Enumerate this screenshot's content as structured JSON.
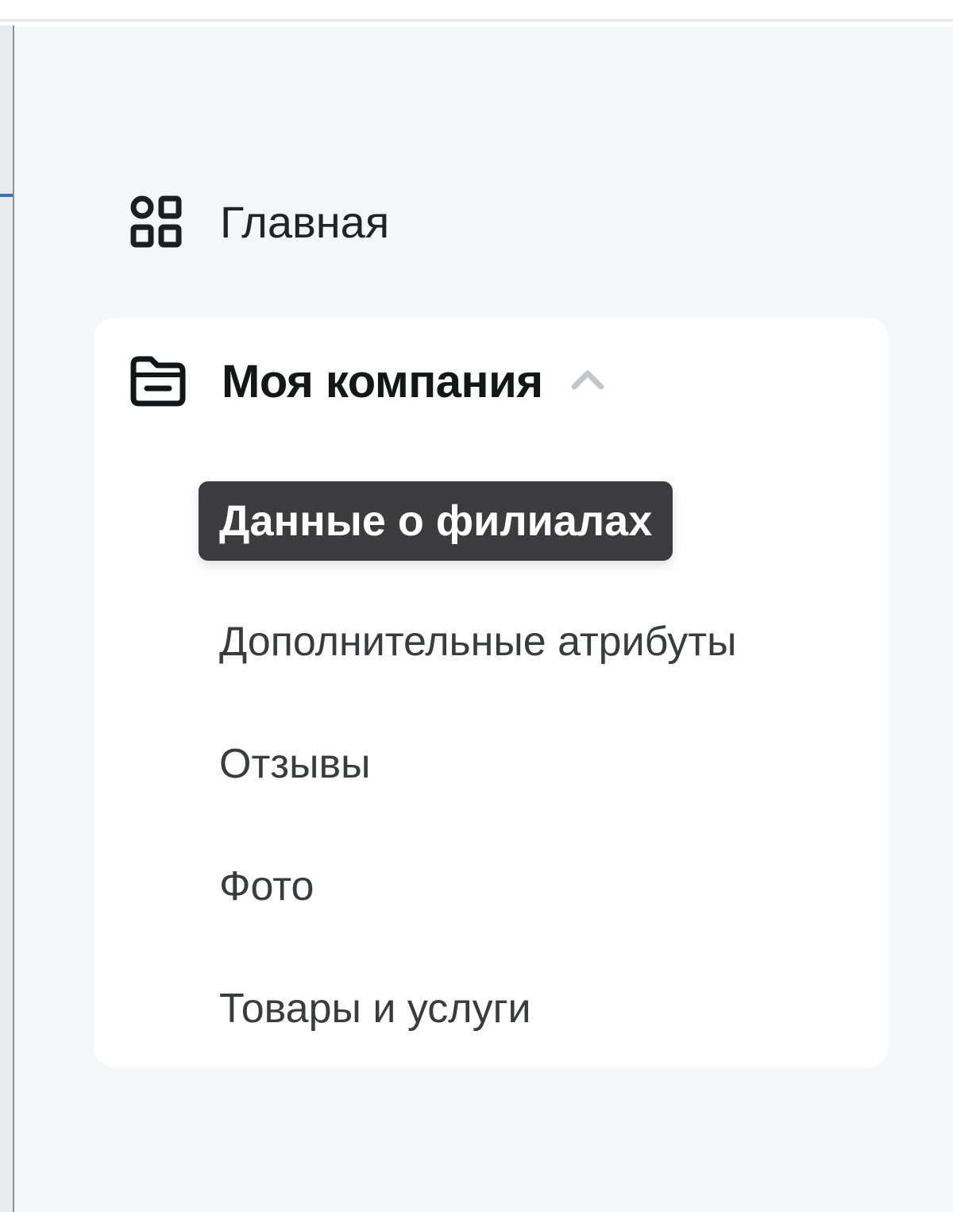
{
  "sidebar": {
    "home": {
      "label": "Главная",
      "icon": "dashboard-grid-icon"
    },
    "group": {
      "label": "Моя компания",
      "icon": "folder-icon",
      "expanded_icon": "chevron-up-icon",
      "items": [
        {
          "label": "Данные о филиалах",
          "active": true
        },
        {
          "label": "Дополнительные атрибуты",
          "active": false
        },
        {
          "label": "Отзывы",
          "active": false
        },
        {
          "label": "Фото",
          "active": false
        },
        {
          "label": "Товары и услуги",
          "active": false
        }
      ]
    }
  },
  "colors": {
    "sidebar_bg": "#f5f6f8",
    "card_bg": "#ffffff",
    "active_item_bg": "#3c3c3e",
    "text_primary": "#151618",
    "text_secondary": "#3a3b3e",
    "chevron": "#c4c5c9"
  }
}
